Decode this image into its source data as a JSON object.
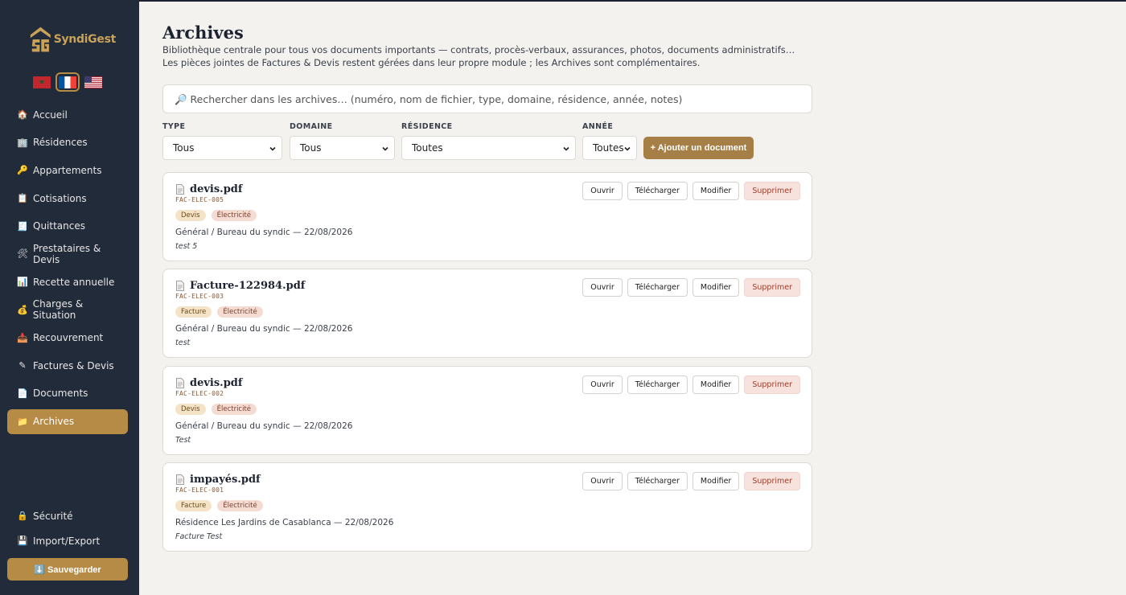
{
  "app": {
    "name": "SyndiGest"
  },
  "flags": [
    {
      "name": "morocco-flag",
      "active": false
    },
    {
      "name": "france-flag",
      "active": true
    },
    {
      "name": "usa-flag",
      "active": false
    }
  ],
  "sidebar": {
    "items": [
      {
        "label": "Accueil",
        "icon": "house-icon",
        "glyph": "🏠"
      },
      {
        "label": "Résidences",
        "icon": "building-icon",
        "glyph": "🏢"
      },
      {
        "label": "Appartements",
        "icon": "key-icon",
        "glyph": "🔑"
      },
      {
        "label": "Cotisations",
        "icon": "clipboard-icon",
        "glyph": "📋"
      },
      {
        "label": "Quittances",
        "icon": "receipt-icon",
        "glyph": "🧾"
      },
      {
        "label": "Prestataires & Devis",
        "icon": "tools-icon",
        "glyph": "🛠"
      },
      {
        "label": "Recette annuelle",
        "icon": "bar-chart-icon",
        "glyph": "📊"
      },
      {
        "label": "Charges & Situation",
        "icon": "money-bag-icon",
        "glyph": "💰"
      },
      {
        "label": "Recouvrement",
        "icon": "inbox-icon",
        "glyph": "📥"
      },
      {
        "label": "Factures & Devis",
        "icon": "pen-icon",
        "glyph": "✎"
      },
      {
        "label": "Documents",
        "icon": "document-icon",
        "glyph": "📄"
      },
      {
        "label": "Archives",
        "icon": "folder-icon",
        "glyph": "📁"
      }
    ],
    "bottom": [
      {
        "label": "Sécurité",
        "icon": "lock-icon",
        "glyph": "🔒"
      },
      {
        "label": "Import/Export",
        "icon": "floppy-icon",
        "glyph": "💾"
      }
    ],
    "save_label": "⬇️ Sauvegarder"
  },
  "main": {
    "title": "Archives",
    "description": "Bibliothèque centrale pour tous vos documents importants — contrats, procès-verbaux, assurances, photos, documents administratifs… Les pièces jointes de Factures & Devis restent gérées dans leur propre module ; les Archives sont complémentaires.",
    "search_placeholder": "🔎 Rechercher dans les archives… (numéro, nom de fichier, type, domaine, résidence, année, notes)"
  },
  "filters": {
    "type": {
      "label": "TYPE",
      "value": "Tous"
    },
    "domaine": {
      "label": "DOMAINE",
      "value": "Tous"
    },
    "residence": {
      "label": "RÉSIDENCE",
      "value": "Toutes"
    },
    "annee": {
      "label": "ANNÉE",
      "value": "Toutes"
    },
    "add_label": "+ Ajouter un document"
  },
  "actions": {
    "open": "Ouvrir",
    "download": "Télécharger",
    "edit": "Modifier",
    "delete": "Supprimer"
  },
  "documents": [
    {
      "title": "devis.pdf",
      "code": "FAC-ELEC-005",
      "type": "Devis",
      "domain": "Électricité",
      "meta": "Général / Bureau du syndic — 22/08/2026",
      "note": "test 5"
    },
    {
      "title": "Facture-122984.pdf",
      "code": "FAC-ELEC-003",
      "type": "Facture",
      "domain": "Électricité",
      "meta": "Général / Bureau du syndic — 22/08/2026",
      "note": "test"
    },
    {
      "title": "devis.pdf",
      "code": "FAC-ELEC-002",
      "type": "Devis",
      "domain": "Électricité",
      "meta": "Général / Bureau du syndic — 22/08/2026",
      "note": "Test"
    },
    {
      "title": "impayés.pdf",
      "code": "FAC-ELEC-001",
      "type": "Facture",
      "domain": "Électricité",
      "meta": "Résidence Les Jardins de Casablanca — 22/08/2026",
      "note": "Facture Test"
    }
  ]
}
